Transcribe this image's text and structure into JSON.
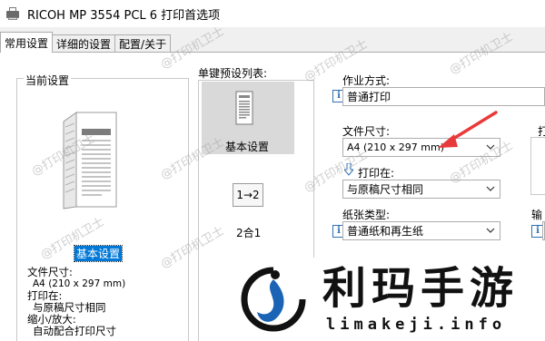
{
  "window": {
    "title": "RICOH MP 3554 PCL 6 打印首选项"
  },
  "tabs": [
    {
      "label": "常用设置",
      "active": true
    },
    {
      "label": "详细的设置",
      "active": false
    },
    {
      "label": "配置/关于",
      "active": false
    }
  ],
  "current_settings": {
    "group_label": "当前设置",
    "selected_name": "基本设置",
    "paper_size_label": "文件尺寸:",
    "paper_size_value": "A4 (210 x 297 mm)",
    "print_on_label": "打印在:",
    "print_on_value": "与原稿尺寸相同",
    "scale_label": "缩小/放大:",
    "scale_value": "自动配合打印尺寸"
  },
  "presets": {
    "label": "单键预设列表:",
    "items": [
      {
        "label": "基本设置",
        "icon": "document-page-icon",
        "selected": true
      },
      {
        "label": "2合1",
        "icon": "two-in-one-icon",
        "icon_text": "1→2",
        "selected": false
      }
    ]
  },
  "job": {
    "job_type_label": "作业方式:",
    "job_type_value": "普通打印",
    "paper_size_label": "文件尺寸:",
    "paper_size_value": "A4 (210 x 297 mm)",
    "print_on_label": "打印在:",
    "print_on_value": "与原稿尺寸相同",
    "paper_type_label": "纸张类型:",
    "paper_type_value": "普通纸和再生纸",
    "right_cut_label_1": "打",
    "right_cut_label_2": "输"
  },
  "watermark": "@打印机卫士",
  "logo": {
    "text": "利玛手游",
    "domain": "limakeji.info"
  },
  "colors": {
    "selection": "#0078d7",
    "arrow": "#e83a3a",
    "info_icon": "#2e6fb5",
    "logo_dark": "#111111",
    "logo_blue": "#1a63b5"
  }
}
